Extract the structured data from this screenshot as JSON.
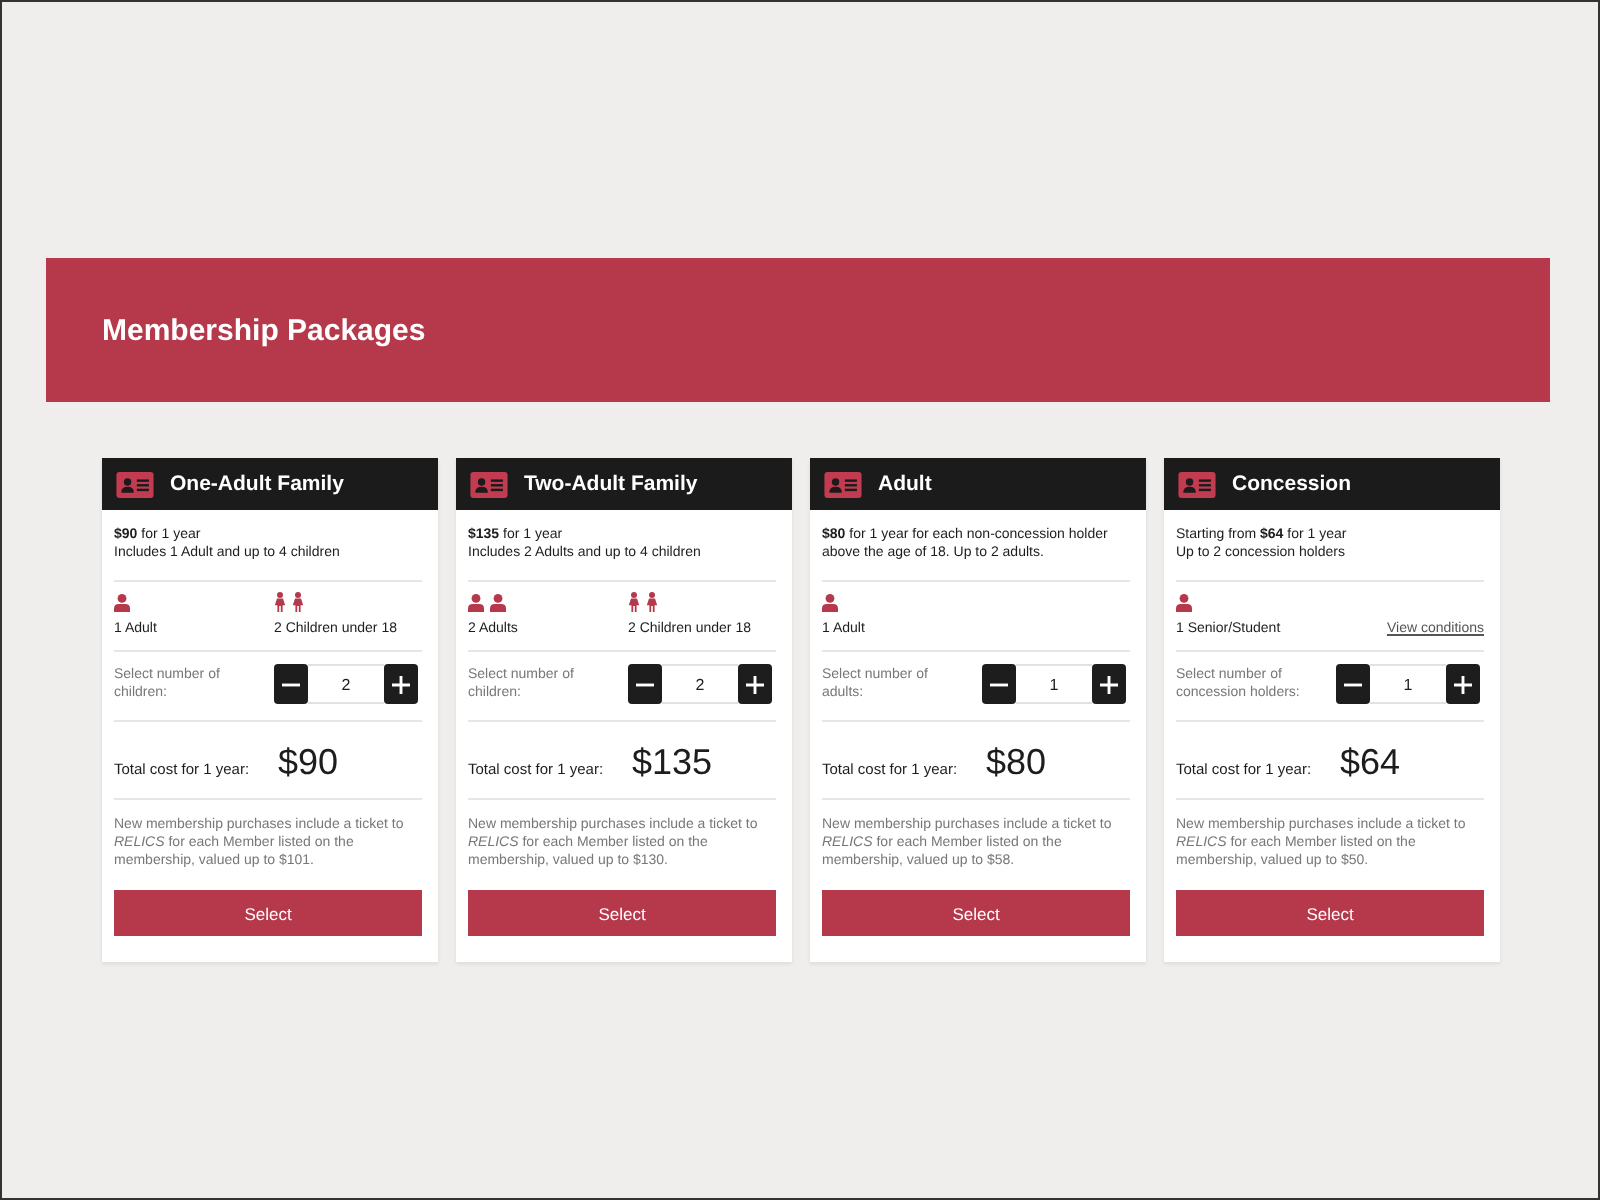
{
  "banner": {
    "title": "Membership Packages"
  },
  "packages": [
    {
      "title": "One-Adult Family",
      "description": [
        "**$90** for 1 year",
        "Includes 1 Adult and up to 4 children"
      ],
      "members": [
        {
          "label": "1 Adult",
          "figures": [
            {
              "kind": "adult"
            }
          ]
        },
        {
          "label": "2 Children under 18",
          "figures": [
            {
              "kind": "child"
            },
            {
              "kind": "child"
            }
          ]
        }
      ],
      "selector": {
        "label": "Select number of children:",
        "value": "2"
      },
      "total": {
        "label": "Total cost for 1 year:",
        "price": "$90"
      },
      "note": "New membership purchases include a ticket to *RELICS* for each Member listed on the membership, valued up to $101.",
      "button": "Select"
    },
    {
      "title": "Two-Adult Family",
      "description": [
        "**$135** for 1 year",
        "Includes 2 Adults and up to 4 children"
      ],
      "members": [
        {
          "label": "2 Adults",
          "figures": [
            {
              "kind": "adult"
            },
            {
              "kind": "adult"
            }
          ]
        },
        {
          "label": "2 Children under 18",
          "figures": [
            {
              "kind": "child"
            },
            {
              "kind": "child"
            }
          ]
        }
      ],
      "selector": {
        "label": "Select number of children:",
        "value": "2"
      },
      "total": {
        "label": "Total cost for 1 year:",
        "price": "$135"
      },
      "note": "New membership purchases include a ticket to *RELICS* for each Member listed on the membership, valued up to $130.",
      "button": "Select"
    },
    {
      "title": "Adult",
      "description": [
        "**$80** for 1 year for each non-concession holder above the age of 18. Up to 2 adults."
      ],
      "members": [
        {
          "label": "1 Adult",
          "figures": [
            {
              "kind": "adult"
            }
          ]
        }
      ],
      "selector": {
        "label": "Select number of adults:",
        "value": "1"
      },
      "total": {
        "label": "Total cost for 1 year:",
        "price": "$80"
      },
      "note": "New membership purchases include a ticket to *RELICS* for each Member listed on the membership, valued up to $58.",
      "button": "Select"
    },
    {
      "title": "Concession",
      "description": [
        "Starting from **$64** for 1 year",
        "Up to 2 concession holders"
      ],
      "members": [
        {
          "label": "1 Senior/Student",
          "figures": [
            {
              "kind": "adult"
            }
          ]
        }
      ],
      "conditions_link": "View conditions",
      "selector": {
        "label": "Select number of concession holders:",
        "value": "1"
      },
      "total": {
        "label": "Total cost for 1 year:",
        "price": "$64"
      },
      "note": "New membership purchases include a ticket to *RELICS* for each Member listed on the membership, valued up to $50.",
      "button": "Select"
    }
  ]
}
